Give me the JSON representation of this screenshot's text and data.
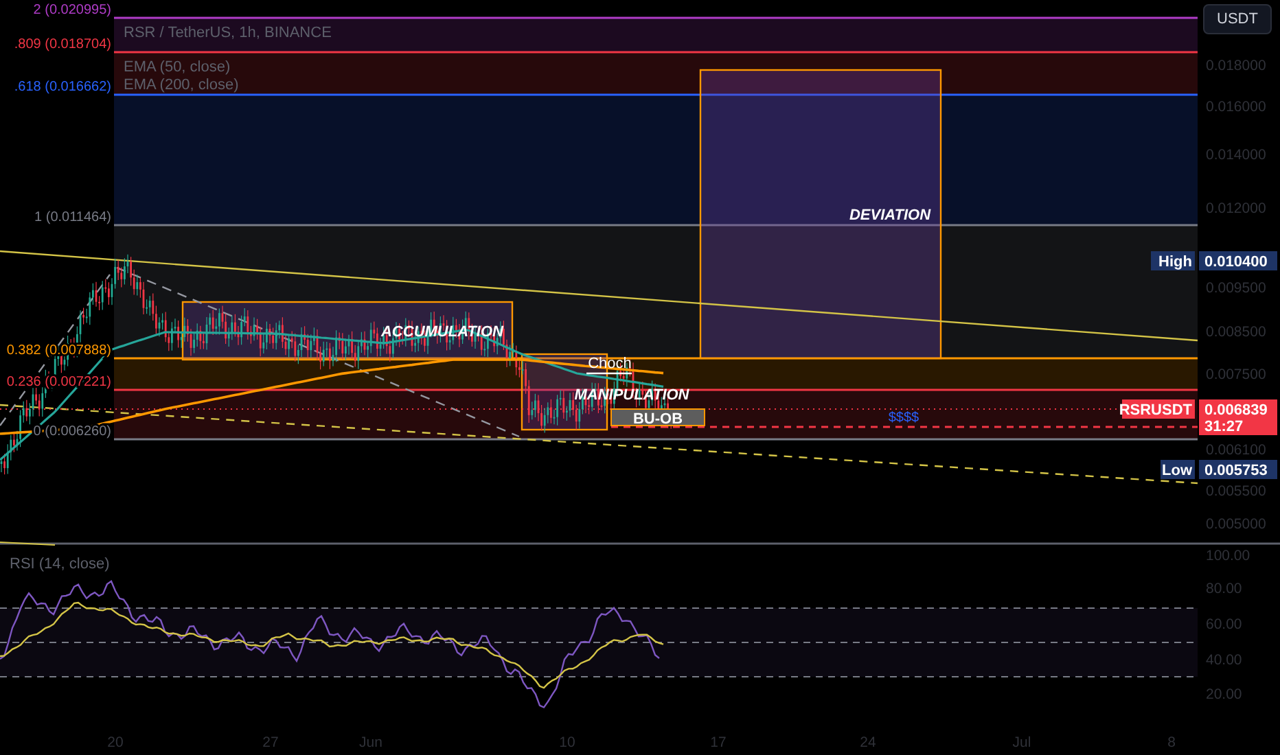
{
  "legend": {
    "title": "RSR / TetherUS, 1h, BINANCE",
    "indicators": [
      "EMA (50, close)",
      "EMA (200, close)"
    ]
  },
  "fib_levels": [
    {
      "label": "2 (0.020995)",
      "color": "#b03cc8"
    },
    {
      "label": ".809 (0.018704)",
      "color": "#f23645"
    },
    {
      "label": ".618 (0.016662)",
      "color": "#2962ff"
    },
    {
      "label": "1 (0.011464)",
      "color": "#787b86"
    },
    {
      "label": "0.382 (0.007888)",
      "color": "#ff9800"
    },
    {
      "label": "0.236 (0.007221)",
      "color": "#f23645"
    },
    {
      "label": "0 (0.006260)",
      "color": "#787b86"
    }
  ],
  "annotations": {
    "deviation": "DEVIATION",
    "accumulation": "ACCUMULATION",
    "choch": "Choch",
    "manipulation": "MANIPULATION",
    "order_block": "BU-OB",
    "liquidity": "$$$$"
  },
  "price_axis": {
    "currency_button": "USDT",
    "ticks": [
      "0.018000",
      "0.016000",
      "0.014000",
      "0.012000",
      "0.009500",
      "0.008500",
      "0.007500",
      "0.006100",
      "0.005500",
      "0.005000"
    ]
  },
  "price_tags": [
    {
      "kind": "high",
      "label": "High",
      "value": "0.010400"
    },
    {
      "kind": "current",
      "label": "RSRUSDT",
      "value": "0.006839",
      "countdown": "31:27"
    },
    {
      "kind": "low",
      "label": "Low",
      "value": "0.005753"
    }
  ],
  "rsi": {
    "title": "RSI (14, close)",
    "ticks": [
      "100.00",
      "80.00",
      "60.00",
      "40.00",
      "20.00"
    ]
  },
  "time_axis": [
    "20",
    "27",
    "Jun",
    "10",
    "17",
    "24",
    "Jul",
    "8"
  ]
}
